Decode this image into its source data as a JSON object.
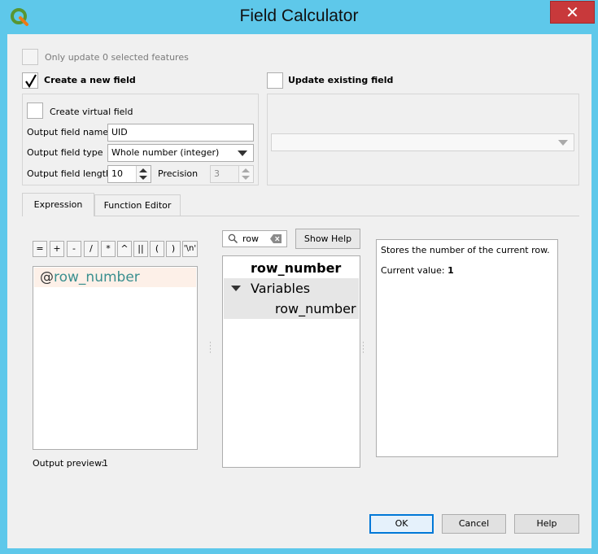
{
  "window": {
    "title": "Field Calculator",
    "close_glyph": "✕"
  },
  "top": {
    "only_update_label": "Only update 0 selected features",
    "create_new_label": "Create a new field",
    "update_existing_label": "Update existing field"
  },
  "new_field": {
    "virtual_label": "Create virtual field",
    "name_label": "Output field name",
    "name_value": "UID",
    "type_label": "Output field type",
    "type_value": "Whole number (integer)",
    "length_label": "Output field length",
    "length_value": "10",
    "precision_label": "Precision",
    "precision_value": "3"
  },
  "tabs": [
    {
      "label": "Expression"
    },
    {
      "label": "Function Editor"
    }
  ],
  "operators": [
    "=",
    "+",
    "-",
    "/",
    "*",
    "^",
    "||",
    "(",
    ")",
    "'\\n'"
  ],
  "expression": {
    "prefix": "@",
    "text": "row_number",
    "output_preview_label": "Output preview:",
    "output_preview_value": "1"
  },
  "search": {
    "value": "row",
    "show_help_label": "Show Help"
  },
  "tree": {
    "top_item": "row_number",
    "group": "Variables",
    "child": "row_number"
  },
  "help": {
    "description": "Stores the number of the current row.",
    "current_value_label": "Current value:",
    "current_value": "1"
  },
  "buttons": {
    "ok": "OK",
    "cancel": "Cancel",
    "help": "Help"
  },
  "colors": {
    "title_bar": "#5ec8ea",
    "close_button": "#c8393b",
    "expression_variable": "#3a8f8f",
    "qgis_green": "#589632",
    "qgis_yellow": "#ee7913"
  }
}
